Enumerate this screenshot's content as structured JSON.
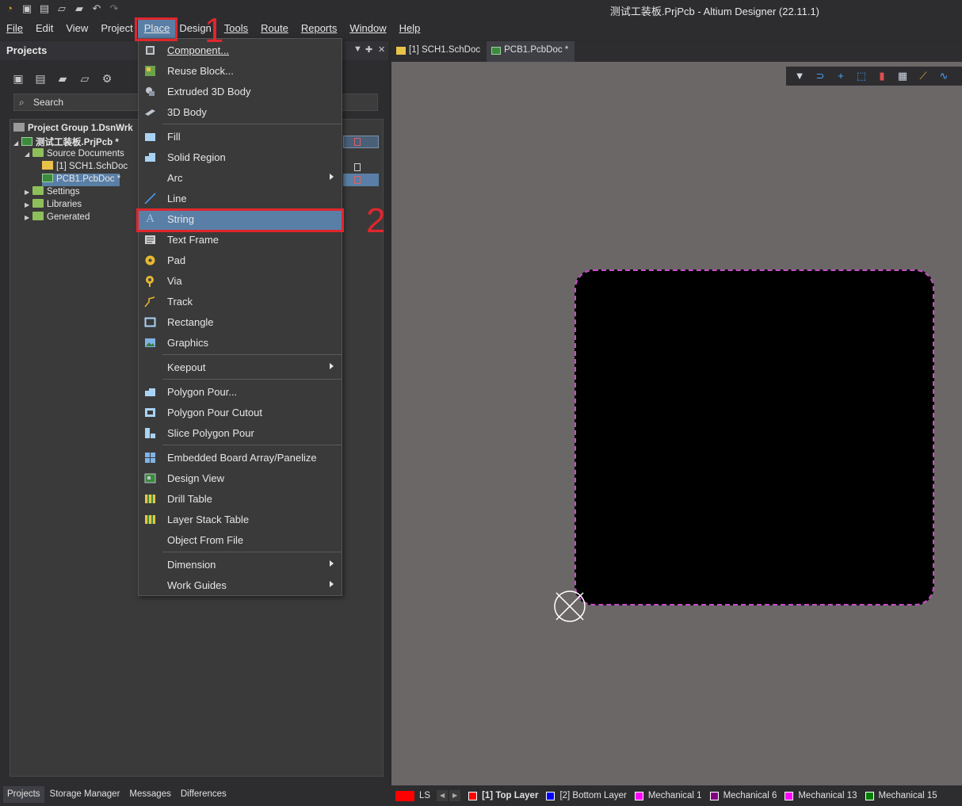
{
  "window": {
    "title": "测试工装板.PrjPcb - Altium Designer (22.11.1)"
  },
  "menubar": {
    "items": [
      "File",
      "Edit",
      "View",
      "Project",
      "Place",
      "Design",
      "Tools",
      "Route",
      "Reports",
      "Window",
      "Help"
    ],
    "active": "Place"
  },
  "annotations": {
    "callout_1": "1",
    "callout_2": "2"
  },
  "projects_panel": {
    "title": "Projects",
    "search_placeholder": "Search",
    "tree": {
      "group": "Project Group 1.DsnWrk",
      "project": "测试工装板.PrjPcb *",
      "source_documents": "Source Documents",
      "sch_doc": "[1] SCH1.SchDoc",
      "pcb_doc": "PCB1.PcbDoc *",
      "settings": "Settings",
      "libraries": "Libraries",
      "generated": "Generated"
    }
  },
  "bottom_tabs": [
    "Projects",
    "Storage Manager",
    "Messages",
    "Differences"
  ],
  "doc_tabs": {
    "sch": "[1] SCH1.SchDoc",
    "pcb": "PCB1.PcbDoc *"
  },
  "place_menu": {
    "component": "Component...",
    "reuse_block": "Reuse Block...",
    "extruded_3d_body": "Extruded 3D Body",
    "body_3d": "3D Body",
    "fill": "Fill",
    "solid_region": "Solid Region",
    "arc": "Arc",
    "line": "Line",
    "string": "String",
    "text_frame": "Text Frame",
    "pad": "Pad",
    "via": "Via",
    "track": "Track",
    "rectangle": "Rectangle",
    "graphics": "Graphics",
    "keepout": "Keepout",
    "polygon_pour": "Polygon Pour...",
    "polygon_pour_cutout": "Polygon Pour Cutout",
    "slice_polygon_pour": "Slice Polygon Pour",
    "embedded_board_array": "Embedded Board Array/Panelize",
    "design_view": "Design View",
    "drill_table": "Drill Table",
    "layer_stack_table": "Layer Stack Table",
    "object_from_file": "Object From File",
    "dimension": "Dimension",
    "work_guides": "Work Guides",
    "highlighted": "String"
  },
  "layer_bar": {
    "ls_label": "LS",
    "layers": [
      {
        "name": "[1] Top Layer",
        "color": "#ff0000"
      },
      {
        "name": "[2] Bottom Layer",
        "color": "#0000ff"
      },
      {
        "name": "Mechanical 1",
        "color": "#ff00ff"
      },
      {
        "name": "Mechanical 6",
        "color": "#800080"
      },
      {
        "name": "Mechanical 13",
        "color": "#ff00ff"
      },
      {
        "name": "Mechanical 15",
        "color": "#008000"
      }
    ],
    "active_layer": "[1] Top Layer"
  },
  "colors": {
    "board_fill": "#000000",
    "board_outline": "#c64bc6",
    "canvas_bg": "#6b6767",
    "highlight": "#5a7fa6",
    "annotation_red": "#e0262d"
  }
}
